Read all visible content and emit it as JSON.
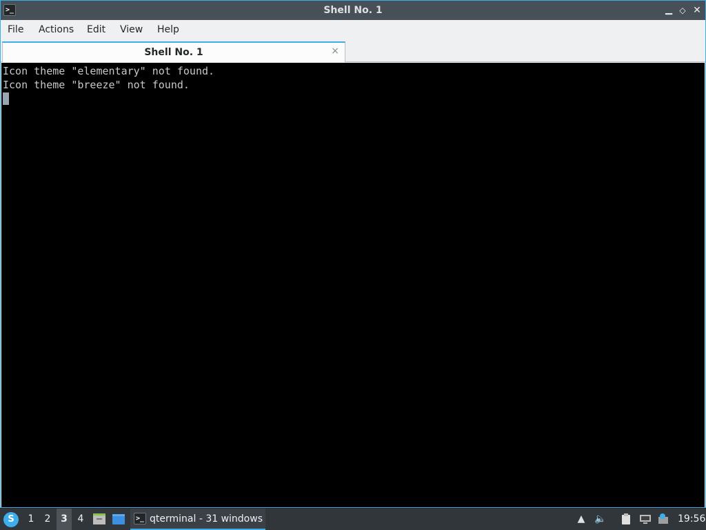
{
  "window": {
    "title": "Shell No. 1",
    "controls": {
      "minimize": "▁",
      "maximize": "◇",
      "close": "✕"
    }
  },
  "menubar": {
    "items": [
      {
        "label": "File"
      },
      {
        "label": "Actions"
      },
      {
        "label": "Edit"
      },
      {
        "label": "View"
      },
      {
        "label": "Help"
      }
    ]
  },
  "tabs": [
    {
      "label": "Shell No. 1",
      "active": true,
      "close": "×"
    }
  ],
  "terminal": {
    "lines": [
      "Icon theme \"elementary\" not found.",
      "Icon theme \"breeze\" not found."
    ]
  },
  "taskbar": {
    "desktops": [
      "1",
      "2",
      "3",
      "4"
    ],
    "active_desktop": "3",
    "task": {
      "label": "qterminal - 31 windows"
    },
    "clock": "19:56"
  },
  "colors": {
    "accent": "#3daee9",
    "titlebar": "#475057",
    "terminal_bg": "#000000",
    "terminal_fg": "#c8c8c8",
    "taskbar": "#31363b"
  }
}
